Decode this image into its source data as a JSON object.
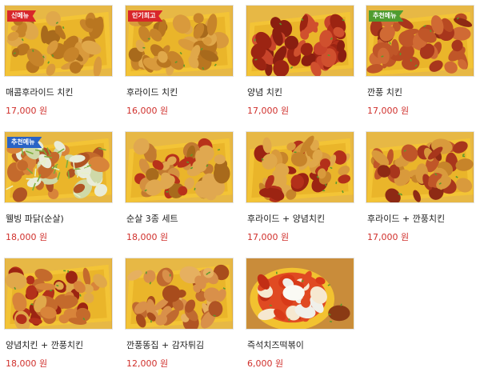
{
  "menu": {
    "items": [
      {
        "name": "매콤후라이드 치킨",
        "price": "17,000",
        "currency": "원",
        "badge": "신메뉴",
        "badge_color": "red",
        "tone": "fried"
      },
      {
        "name": "후라이드 치킨",
        "price": "16,000",
        "currency": "원",
        "badge": "인기최고",
        "badge_color": "red",
        "tone": "fried"
      },
      {
        "name": "양념 치킨",
        "price": "17,000",
        "currency": "원",
        "badge": "",
        "badge_color": "",
        "tone": "sauce"
      },
      {
        "name": "깐풍 치킨",
        "price": "17,000",
        "currency": "원",
        "badge": "추천메뉴",
        "badge_color": "green",
        "tone": "kkanpung"
      },
      {
        "name": "웰빙 파닭(순살)",
        "price": "18,000",
        "currency": "원",
        "badge": "추천메뉴",
        "badge_color": "blue",
        "tone": "padak"
      },
      {
        "name": "순살 3종 세트",
        "price": "18,000",
        "currency": "원",
        "badge": "",
        "badge_color": "",
        "tone": "mix"
      },
      {
        "name": "후라이드 + 양념치킨",
        "price": "17,000",
        "currency": "원",
        "badge": "",
        "badge_color": "",
        "tone": "half"
      },
      {
        "name": "후라이드 + 깐풍치킨",
        "price": "17,000",
        "currency": "원",
        "badge": "",
        "badge_color": "",
        "tone": "half2"
      },
      {
        "name": "양념치킨 + 깐풍치킨",
        "price": "18,000",
        "currency": "원",
        "badge": "",
        "badge_color": "",
        "tone": "sauce2"
      },
      {
        "name": "깐풍똥집 + 감자튀김",
        "price": "12,000",
        "currency": "원",
        "badge": "",
        "badge_color": "",
        "tone": "gizzard"
      },
      {
        "name": "즉석치즈떡볶이",
        "price": "6,000",
        "currency": "원",
        "badge": "",
        "badge_color": "",
        "tone": "tteok"
      }
    ]
  },
  "colors": {
    "price": "#d0302c",
    "name": "#222222",
    "tray": "#f3c436",
    "fried": "#c98a2c",
    "sauce": "#b8321a"
  }
}
